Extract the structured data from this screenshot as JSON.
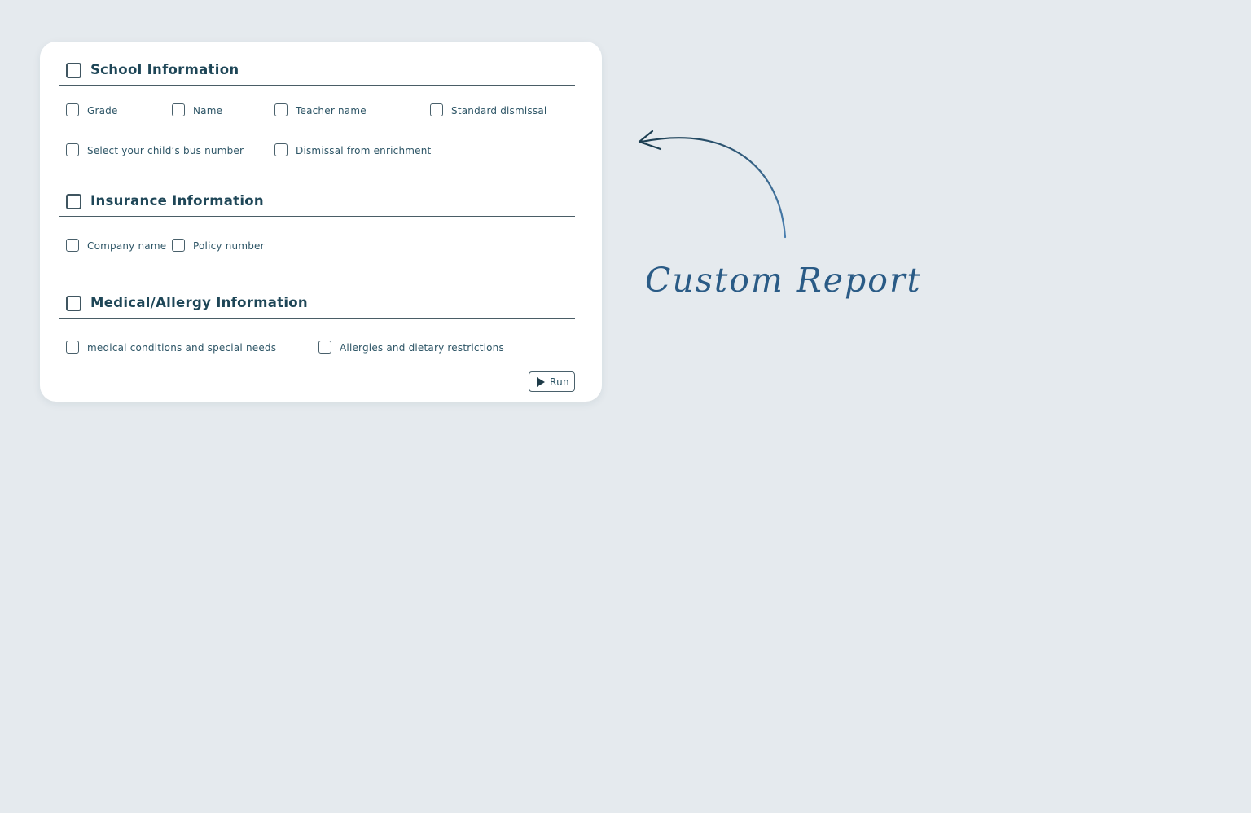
{
  "title": "Custom Report",
  "colors": {
    "background": "#e5eaee",
    "card": "#ffffff",
    "heading_text": "#1e4657",
    "accent_blue": "#2a5b86"
  },
  "sections": [
    {
      "title": "School Information",
      "checked": false,
      "options": [
        "Grade",
        "Name",
        "Teacher name",
        "Standard dismissal",
        "Select your child’s bus number",
        "Dismissal from enrichment"
      ]
    },
    {
      "title": "Insurance Information",
      "checked": false,
      "options": [
        "Company name",
        "Policy number"
      ]
    },
    {
      "title": "Medical/Allergy Information",
      "checked": false,
      "options": [
        "medical conditions and special needs",
        "Allergies and dietary restrictions"
      ]
    }
  ],
  "run_button": {
    "label": "Run",
    "icon": "play-icon"
  },
  "annotation_icon": "curved-arrow-icon"
}
